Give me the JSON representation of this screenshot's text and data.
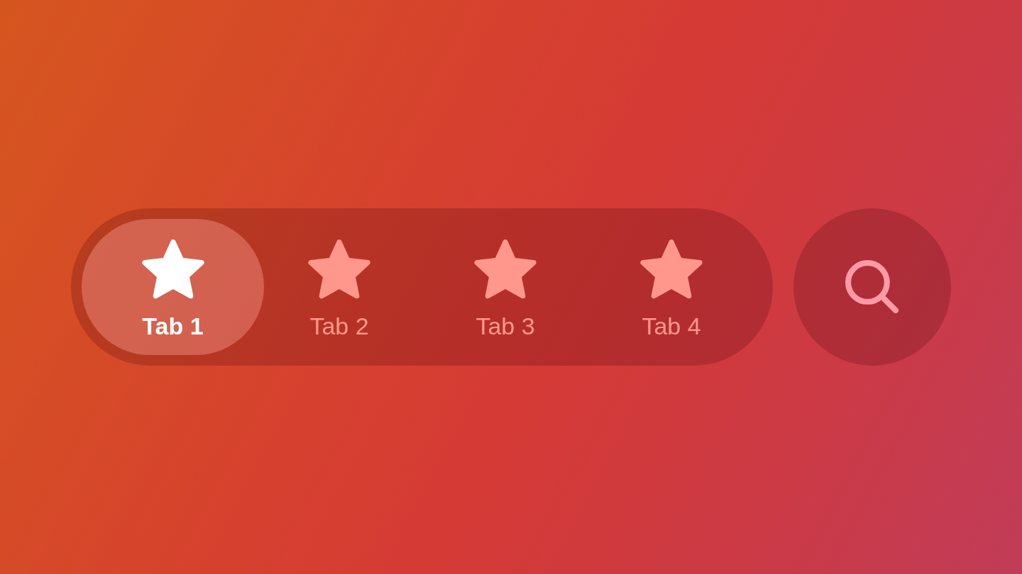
{
  "tab_bar": {
    "tabs": [
      {
        "label": "Tab 1",
        "selected": true
      },
      {
        "label": "Tab 2",
        "selected": false
      },
      {
        "label": "Tab 3",
        "selected": false
      },
      {
        "label": "Tab 4",
        "selected": false
      }
    ]
  }
}
